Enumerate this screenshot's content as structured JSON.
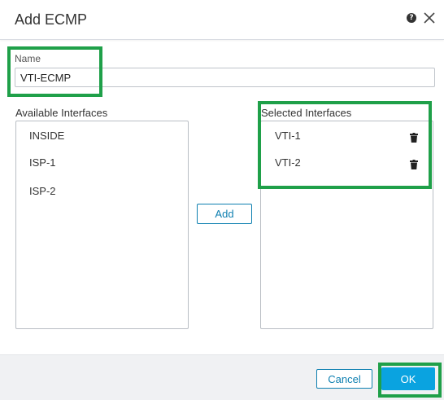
{
  "dialog": {
    "title": "Add ECMP",
    "help_icon": "help-icon",
    "close_icon": "close-icon"
  },
  "name": {
    "label": "Name",
    "value": "VTI-ECMP"
  },
  "available": {
    "label": "Available Interfaces",
    "items": [
      "INSIDE",
      "ISP-1",
      "ISP-2"
    ]
  },
  "add_button": "Add",
  "selected": {
    "label": "Selected Interfaces",
    "items": [
      "VTI-1",
      "VTI-2"
    ],
    "remove_icon": "trash-icon"
  },
  "footer": {
    "cancel_label": "Cancel",
    "ok_label": "OK"
  },
  "colors": {
    "accent": "#0aa3e0",
    "link": "#0d7fb0",
    "highlight": "#1fa049"
  }
}
